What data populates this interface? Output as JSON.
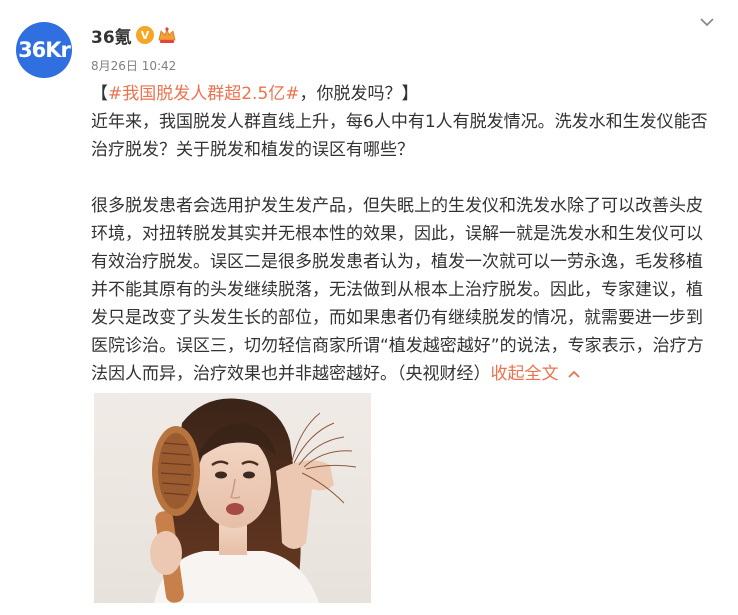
{
  "account": {
    "avatar_text": "36Kr",
    "name": "36氪",
    "verified_mark": "V",
    "timestamp": "8月26日 10:42"
  },
  "icons": {
    "menu": "chevron-down-icon",
    "verified": "verified-badge-icon",
    "member": "member-crown-icon",
    "collapse": "chevron-up-icon"
  },
  "post": {
    "headline_open": "【",
    "headline_hashtag": "#我国脱发人群超2.5亿#",
    "headline_rest": "，你脱发吗？】",
    "paragraph1": "近年来，我国脱发人群直线上升，每6人中有1人有脱发情况。洗发水和生发仪能否治疗脱发？关于脱发和植发的误区有哪些？",
    "paragraph2": "很多脱发患者会选用护发生发产品，但失眠上的生发仪和洗发水除了可以改善头皮环境，对扭转脱发其实并无根本性的效果，因此，误解一就是洗发水和生发仪可以有效治疗脱发。误区二是很多脱发患者认为，植发一次就可以一劳永逸，毛发移植并不能其原有的头发继续脱落，无法做到从根本上治疗脱发。因此，专家建议，植发只是改变了头发生长的部位，而如果患者仍有继续脱发的情况，就需要进一步到医院诊治。误区三，切勿轻信商家所谓“植发越密越好”的说法，专家表示，治疗方法因人而异，治疗效果也并非越密越好。（央视财经）",
    "collapse_label": "收起全文"
  },
  "colors": {
    "link": "#eb7350",
    "avatar_bg": "#2f6fe0",
    "text": "#333333",
    "meta": "#808080"
  }
}
